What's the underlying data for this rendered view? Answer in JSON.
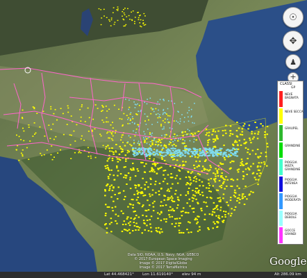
{
  "legend": {
    "title": "CLASSI",
    "gp_label": "GP",
    "items": [
      {
        "label": "NEVE BAGNATA",
        "color": "#ff2020"
      },
      {
        "label": "NEVE SECCA",
        "color": "#ffff00"
      },
      {
        "label": "GRAUPEL",
        "color": "#2eb82e"
      },
      {
        "label": "GRANDINE",
        "color": "#00dd00"
      },
      {
        "label": "PIOGGIA MISTA GRANDINE",
        "color": "#44ffcc"
      },
      {
        "label": "PIOGGIA INTENSA",
        "color": "#1010dd"
      },
      {
        "label": "PIOGGIA MODERATA",
        "color": "#3399ff"
      },
      {
        "label": "PIOGGIA DEBOLE",
        "color": "#99ffff"
      },
      {
        "label": "GOCCE GRANDI",
        "color": "#ff33ff"
      }
    ]
  },
  "map_colors": {
    "snow_dry": "#ffff00",
    "rain_light": "#7fdcf0",
    "borders": "#ff66cc",
    "sea": "#2b4f88",
    "land": "#5b6c3f"
  },
  "credits": [
    "Data SIO, NOAA, U.S. Navy, NGA, GEBCO",
    "© 2017 European Space Imaging",
    "Image © 2017 DigitalGlobe",
    "Image © 2017 TerraMetrics"
  ],
  "branding": "Google",
  "status": {
    "lat": "Lat  44.468421°",
    "lon": "Lon  11.619140°",
    "elev": "elev   94 m",
    "eye": "Alt  286.09 km"
  },
  "nav": {
    "zoom_in": "+",
    "zoom_out": "−"
  }
}
